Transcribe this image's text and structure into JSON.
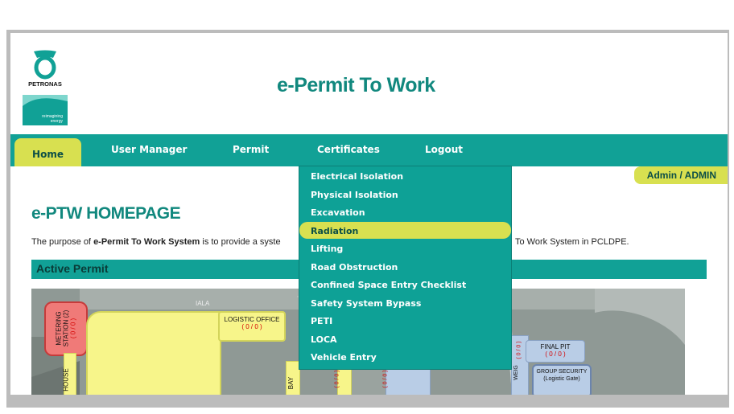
{
  "header": {
    "logo_brand": "PETRONAS",
    "logo_tagline": "reimagining energy",
    "app_title": "e-Permit To Work"
  },
  "nav": {
    "items": [
      "Home",
      "User Manager",
      "Permit",
      "Certificates",
      "Logout"
    ],
    "active": "Home"
  },
  "user_badge": "Admin / ADMIN",
  "main": {
    "heading": "e-PTW HOMEPAGE",
    "description": {
      "prefix": "The purpose of ",
      "bold": "e-Permit To Work System",
      "suffix_visible": " is to provide a syste",
      "tail_visible": "To Work System in PCLDPE."
    },
    "active_permit_label": "Active Permit"
  },
  "certificates_menu": {
    "items": [
      "Electrical Isolation",
      "Physical Isolation",
      "Excavation",
      "Radiation",
      "Lifting",
      "Road Obstruction",
      "Confined Space Entry Checklist",
      "Safety System Bypass",
      "PETI",
      "LOCA",
      "Vehicle Entry"
    ],
    "highlighted": "Radiation"
  },
  "map": {
    "labels": {
      "metering_title": "METERING STATION (2)",
      "metering_count": "( 0 / 0 )",
      "logistic_title": "LOGISTIC OFFICE",
      "logistic_count": "( 0 / 0 )",
      "final_pit_title": "FINAL PIT",
      "final_pit_count": "( 0 / 0 )",
      "group_security_title": "GROUP SECURITY",
      "group_security_sub": "(Logistic Gate)",
      "house_label": "HOUSE",
      "bay_label": "BAY",
      "weig_label": "WEIG",
      "ala_label": "IALA",
      "vertical_count_a": "( 0 / 0 )",
      "vertical_count_b": "( 0 / 0 )",
      "vertical_count_c": "( 0 / 0 )"
    },
    "colors": {
      "zone_yellow": "#f7f58a",
      "zone_red": "#f07a78",
      "zone_blue": "#b9cde6",
      "count_red": "#d40000",
      "count_green": "#168a16"
    }
  },
  "colors": {
    "brand_teal": "#11a196",
    "title_teal": "#11887e",
    "accent_yellow": "#d8e050"
  }
}
